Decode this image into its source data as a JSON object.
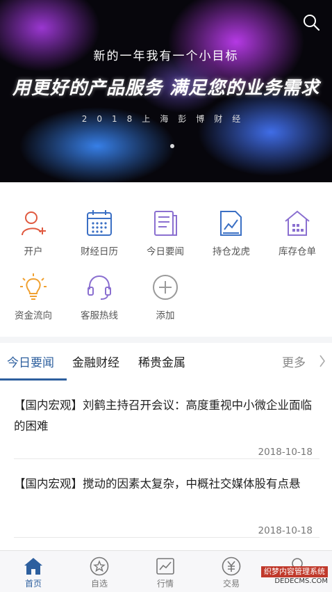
{
  "banner": {
    "subtitle": "新的一年我有一个小目标",
    "headline": "用更好的产品服务 满足您的业务需求",
    "tagline": "2018上海彭博财经"
  },
  "shortcuts": [
    {
      "label": "开户",
      "icon": "user-add-icon"
    },
    {
      "label": "财经日历",
      "icon": "calendar-icon"
    },
    {
      "label": "今日要闻",
      "icon": "news-icon"
    },
    {
      "label": "持仓龙虎",
      "icon": "chart-doc-icon"
    },
    {
      "label": "库存仓单",
      "icon": "warehouse-icon"
    },
    {
      "label": "资金流向",
      "icon": "bulb-icon"
    },
    {
      "label": "客服热线",
      "icon": "headset-icon"
    },
    {
      "label": "添加",
      "icon": "plus-circle-icon"
    }
  ],
  "tabs": {
    "items": [
      "今日要闻",
      "金融财经",
      "稀贵金属"
    ],
    "active_index": 0,
    "more": "更多"
  },
  "news": [
    {
      "title": "【国内宏观】刘鹤主持召开会议：高度重视中小微企业面临的困难",
      "date": "2018-10-18"
    },
    {
      "title": "【国内宏观】搅动的因素太复杂，中概社交媒体股有点悬",
      "date": "2018-10-18"
    }
  ],
  "tabbar": [
    {
      "label": "首页",
      "icon": "home-icon",
      "active": true
    },
    {
      "label": "自选",
      "icon": "star-icon",
      "active": false
    },
    {
      "label": "行情",
      "icon": "trend-icon",
      "active": false
    },
    {
      "label": "交易",
      "icon": "yen-icon",
      "active": false
    },
    {
      "label": "",
      "icon": "user-icon",
      "active": false
    }
  ],
  "watermark": {
    "line1": "织梦内容管理系统",
    "line2": "DEDECMS.COM"
  },
  "colors": {
    "accent": "#2d5f9e",
    "icon_blue": "#3a6fc4",
    "icon_red": "#e0593f",
    "icon_purple": "#8a6fd0",
    "icon_orange": "#f0a030"
  }
}
